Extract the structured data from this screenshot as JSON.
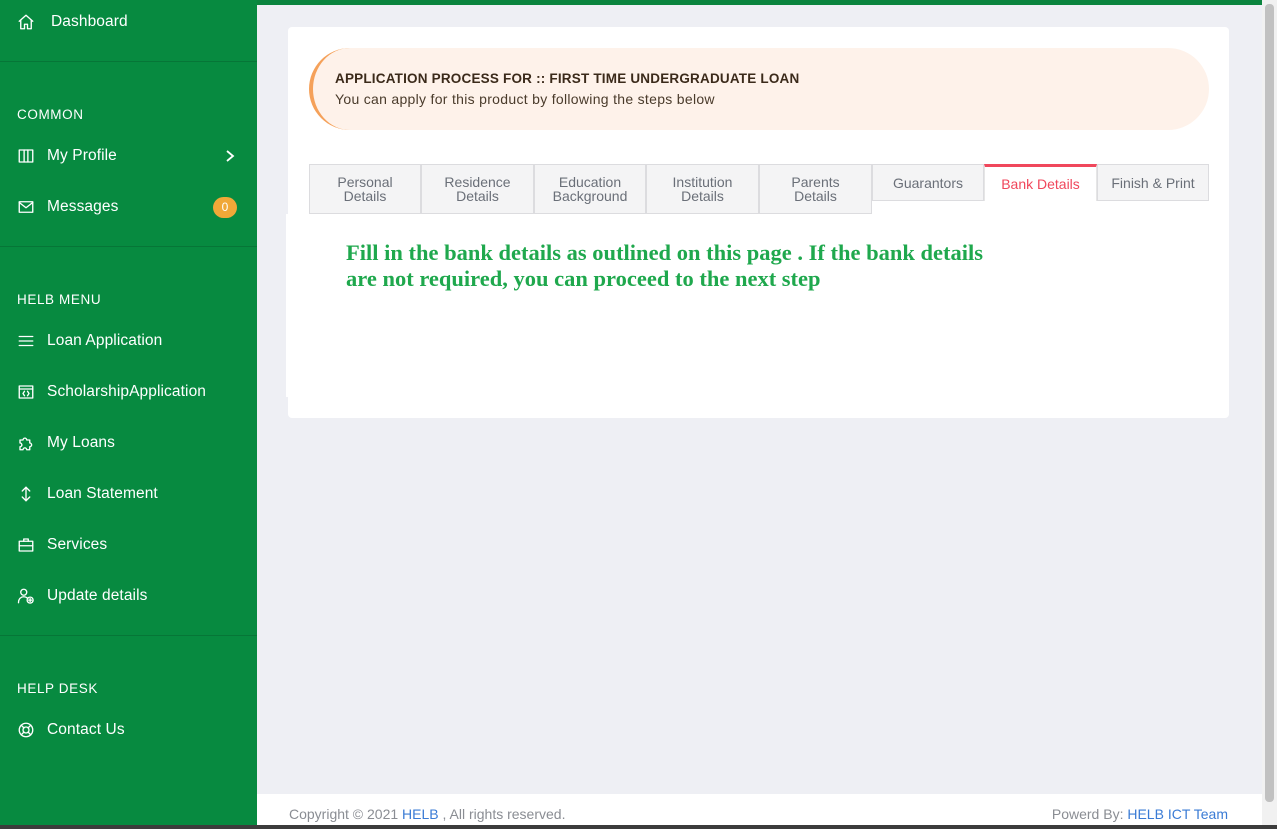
{
  "sidebar": {
    "dashboard": {
      "label": "Dashboard",
      "icon": "home-icon"
    },
    "common_heading": "COMMON",
    "my_profile": {
      "label": "My Profile",
      "icon": "columns-icon"
    },
    "messages": {
      "label": "Messages",
      "icon": "mail-icon",
      "badge": "0"
    },
    "helb_menu_heading": "HELB MENU",
    "loan_application": {
      "label": "Loan Application",
      "icon": "menu-lines-icon"
    },
    "scholarship_application": {
      "label": "ScholarshipApplication",
      "icon": "code-window-icon"
    },
    "my_loans": {
      "label": "My Loans",
      "icon": "puzzle-icon"
    },
    "loan_statement": {
      "label": "Loan Statement",
      "icon": "arrows-vertical-icon"
    },
    "services": {
      "label": "Services",
      "icon": "briefcase-icon"
    },
    "update_details": {
      "label": "Update details",
      "icon": "user-plus-icon"
    },
    "help_desk_heading": "HELP DESK",
    "contact_us": {
      "label": "Contact Us",
      "icon": "lifebuoy-icon"
    }
  },
  "alert": {
    "title": "APPLICATION PROCESS FOR :: FIRST TIME UNDERGRADUATE LOAN",
    "subtitle": "You can apply for this product by following the steps below"
  },
  "tabs": {
    "personal_line1": "Personal",
    "personal_line2": "Details",
    "residence_line1": "Residence",
    "residence_line2": "Details",
    "education_line1": "Education",
    "education_line2": "Background",
    "institution_line1": "Institution",
    "institution_line2": "Details",
    "parents_line1": "Parents",
    "parents_line2": "Details",
    "guarantors": "Guarantors",
    "bank_details": "Bank Details",
    "finish_print": "Finish & Print",
    "active": "Bank Details"
  },
  "panel": {
    "note": "Fill in the bank details as outlined on this page . If the bank details are not required, you can proceed to the next step"
  },
  "footer": {
    "copyright_prefix": "Copyright © 2021",
    "copyright_link": "HELB",
    "copyright_suffix": ", All rights reserved.",
    "powered_prefix": "Powerd By:",
    "powered_link": "HELB ICT Team"
  },
  "colors": {
    "sidebar": "#078a40",
    "active_tab": "#f0475c",
    "note_text": "#1fa84d",
    "badge": "#f0a838",
    "alert_bg": "#fef2ea",
    "alert_accent": "#f5a15a",
    "link": "#3a7bd5"
  }
}
